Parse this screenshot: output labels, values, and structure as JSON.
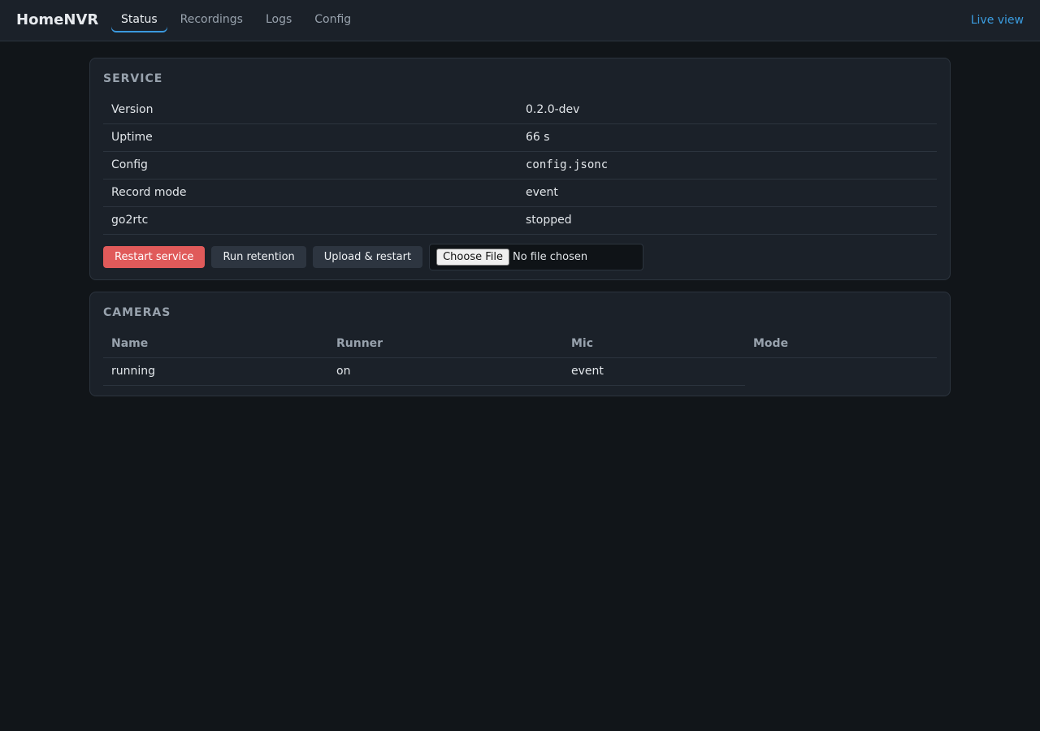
{
  "header": {
    "brand": "HomeNVR",
    "tabs": [
      {
        "label": "Status",
        "active": true
      },
      {
        "label": "Recordings",
        "active": false
      },
      {
        "label": "Logs",
        "active": false
      },
      {
        "label": "Config",
        "active": false
      }
    ],
    "live_view_label": "Live view"
  },
  "service": {
    "title": "SERVICE",
    "rows": [
      {
        "key": "Version",
        "value": "0.2.0-dev"
      },
      {
        "key": "Uptime",
        "value": "66 s"
      },
      {
        "key": "Config",
        "value": "config.jsonc"
      },
      {
        "key": "Record mode",
        "value": "event"
      },
      {
        "key": "go2rtc",
        "value": "stopped"
      }
    ],
    "actions": {
      "restart_label": "Restart service",
      "retention_label": "Run retention",
      "upload_label": "Upload & restart",
      "choose_file_label": "Choose File",
      "file_status": "No file chosen"
    }
  },
  "cameras": {
    "title": "CAMERAS",
    "columns": [
      "Name",
      "Runner",
      "Mic",
      "Mode"
    ],
    "rows": [
      {
        "name": "running",
        "runner": "on",
        "mic": "event",
        "mode": ""
      }
    ]
  },
  "colors": {
    "accent": "#3b9de0",
    "danger": "#e05a5a",
    "success": "#3ec45e",
    "background": "#111519",
    "panel": "#1b2129"
  }
}
